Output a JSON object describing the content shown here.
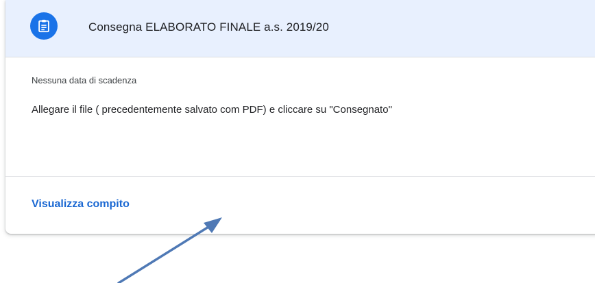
{
  "card": {
    "title": "Consegna ELABORATO FINALE a.s. 2019/20",
    "icon": "assignment-icon",
    "due": "Nessuna data di scadenza",
    "instructions": "Allegare il file ( precedentemente salvato com PDF) e cliccare su \"Consegnato\"",
    "view_link": "Visualizza compito"
  },
  "annotation": {
    "icon": "arrow-icon"
  },
  "colors": {
    "header_bg": "#e8f0fe",
    "accent": "#1a73e8",
    "link": "#1967d2",
    "arrow": "#4f79b5"
  }
}
